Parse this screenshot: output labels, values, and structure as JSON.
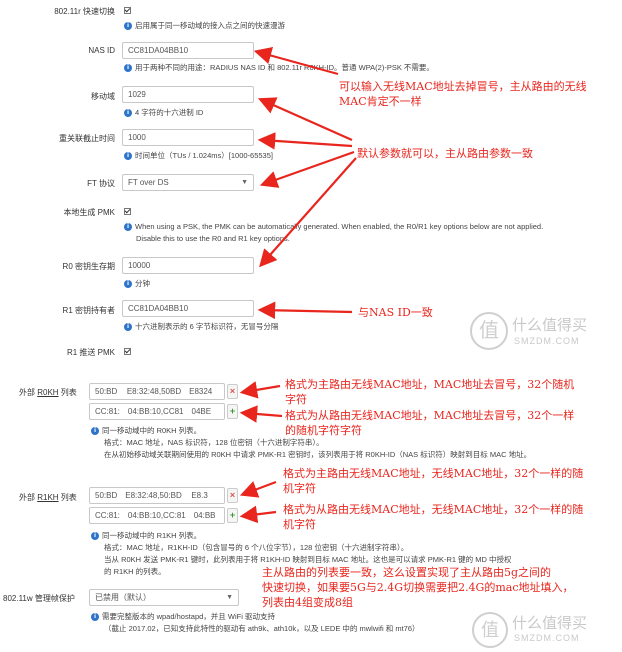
{
  "colors": {
    "annotation": "#e8261e",
    "info_icon": "#2e75c9",
    "remove_button": "#d9534f",
    "add_button": "#3a9a3a"
  },
  "ft_80211r": {
    "label": "802.11r 快速切换",
    "help": "启用属于同一移动域的接入点之间的快速漫游"
  },
  "nas_id": {
    "label": "NAS ID",
    "value": "CC81DA04BB10",
    "help": "用于两种不同的用途：RADIUS NAS ID 和 802.11r R0KH-ID。普通 WPA(2)-PSK 不需要。"
  },
  "mobility_domain": {
    "label": "移动域",
    "value": "1029",
    "help": "4 字符的十六进制 ID"
  },
  "reassoc_deadline": {
    "label": "重关联截止时间",
    "value": "1000",
    "help": "时间单位（TUs / 1.024ms）[1000-65535]"
  },
  "ft_protocol": {
    "label": "FT 协议",
    "value": "FT over DS"
  },
  "local_pmk": {
    "label": "本地生成 PMK",
    "help_line1": "When using a PSK, the PMK can be automatically generated. When enabled, the R0/R1 key options below are not applied.",
    "help_line2": "Disable this to use the R0 and R1 key options."
  },
  "r0_key_lifetime": {
    "label": "R0 密钥生存期",
    "value": "10000",
    "help": "分钟"
  },
  "r1_key_holder": {
    "label": "R1 密钥持有者",
    "value": "CC81DA04BB10",
    "help": "十六进制表示的 6 字节标识符，无冒号分隔"
  },
  "r1_push": {
    "label": "R1 推送 PMK"
  },
  "r0kh": {
    "label_prefix": "外部 ",
    "label_key": "R0KH",
    "label_suffix": " 列表",
    "row1": "50:BD      E8:32:48,50BD     E8324",
    "row2": "CC:81:     04:BB:10,CC81     04BE",
    "help1": "同一移动域中的 R0KH 列表。",
    "help2": "格式：MAC 地址，NAS 标识符，128 位密钥（十六进制字符串）。",
    "help3": "在从初始移动域关联期间使用的 R0KH 中请求 PMK-R1 密钥时，该列表用于将 R0KH-ID（NAS 标识符）映射到目标 MAC 地址。"
  },
  "r1kh": {
    "label_prefix": "外部 ",
    "label_key": "R1KH",
    "label_suffix": " 列表",
    "row1": "50:BD     E8:32:48,50:BD      E8.3",
    "row2": "CC:81:     04:BB:10,CC:81     04:BB",
    "help1": "同一移动域中的 R1KH 列表。",
    "help2": "格式：MAC 地址，R1KH-ID（包含冒号的 6 个八位字节），128 位密钥（十六进制字符串）。",
    "help3": "当从 R0KH 发送 PMK-R1 键时，此列表用于将 R1KH-ID 映射到目标 MAC 地址。这也是可以请求 PMK-R1 键的 MD 中授权",
    "help4": "的 R1KH 的列表。"
  },
  "mgmt_protect": {
    "label": "802.11w 管理帧保护",
    "value": "已禁用（默认）",
    "help1": "需要完整版本的 wpad/hostapd，并且 WiFi 驱动支持",
    "help2": "（截止 2017.02，已知支持此特性的驱动有 ath9k、ath10k，以及 LEDE 中的 mwlwifi 和 mt76）"
  },
  "annotations": {
    "nasid_1": "可以输入无线MAC地址去掉冒号，主从路由的无线",
    "nasid_2": "MAC肯定不一样",
    "defaults": "默认参数就可以，主从路由参数一致",
    "r1holder": "与NAS  ID一致",
    "r0_main_1": "格式为主路由无线MAC地址，MAC地址去冒号，32个随机",
    "r0_main_2": "字符",
    "r0_sub_1": "格式为从路由无线MAC地址，MAC地址去冒号，32个一样",
    "r0_sub_2": "的随机字符字符",
    "r1_main_1": "格式为主路由无线MAC地址，无线MAC地址，32个一样的随",
    "r1_main_2": "机字符",
    "r1_sub_1": "格式为从路由无线MAC地址，无线MAC地址，32个一样的随",
    "r1_sub_2": "机字符",
    "summary_1": "主从路由的列表要一致，这么设置实现了主从路由5g之间的",
    "summary_2": "快速切换，如果要5G与2.4G切换需要把2.4G的mac地址填入，",
    "summary_3": "列表由4组变成8组"
  },
  "watermark": {
    "glyph": "值",
    "title": "什么值得买",
    "site": "SMZDM.COM"
  }
}
